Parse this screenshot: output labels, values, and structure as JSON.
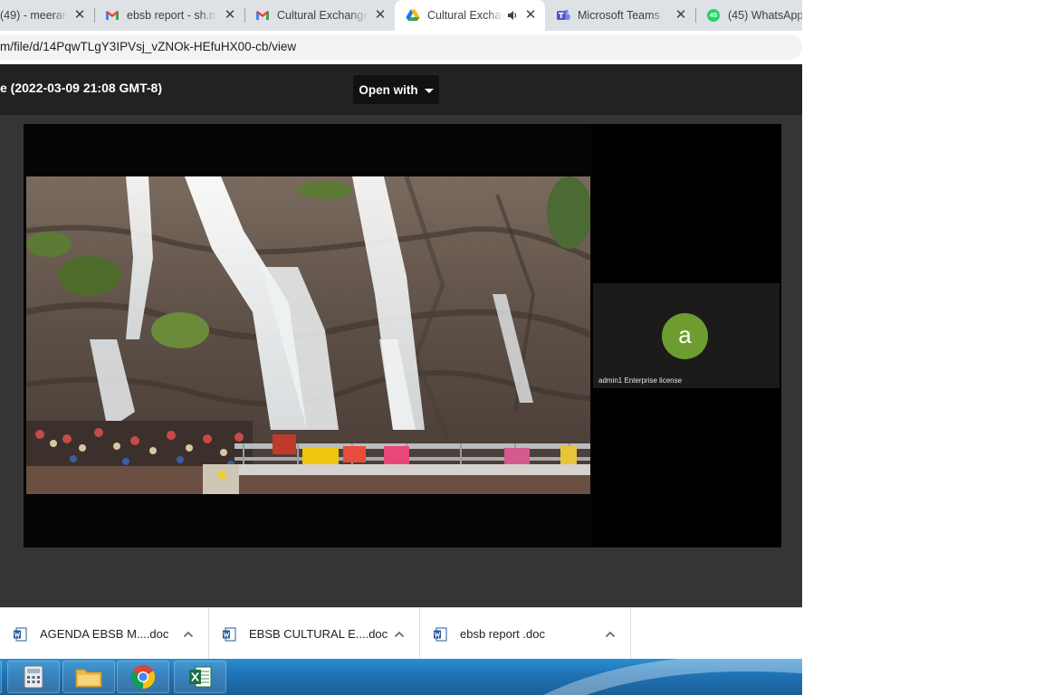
{
  "browser": {
    "tabs": [
      {
        "label": "(49) - meeran",
        "icon": "document-icon",
        "active": false
      },
      {
        "label": "ebsb report - sh.m",
        "icon": "gmail-icon",
        "active": false
      },
      {
        "label": "Cultural Exchange I",
        "icon": "gmail-icon",
        "active": false
      },
      {
        "label": "Cultural Exchan",
        "icon": "google-drive-icon",
        "active": true,
        "audio": true
      },
      {
        "label": "Microsoft Teams",
        "icon": "teams-icon",
        "active": false
      },
      {
        "label": "(45) WhatsApp",
        "icon": "whatsapp-icon",
        "active": false
      }
    ],
    "whatsapp_badge": "45",
    "close_glyph": "✕",
    "url": "m/file/d/14PqwTLgY3IPVsj_vZNOk-HEfuHX00-cb/view"
  },
  "viewer": {
    "title": "e (2022-03-09 21:08 GMT-8)",
    "open_with_label": "Open with",
    "participant": {
      "initial": "a",
      "label": "admin1 Enterprise license"
    }
  },
  "downloads": [
    {
      "name": "AGENDA EBSB M....doc",
      "icon": "word-icon"
    },
    {
      "name": "EBSB CULTURAL E....doc",
      "icon": "word-icon"
    },
    {
      "name": "ebsb report .doc",
      "icon": "word-icon"
    }
  ],
  "taskbar": {
    "apps": [
      "calculator-icon",
      "file-explorer-icon",
      "chrome-icon",
      "excel-icon"
    ]
  },
  "colors": {
    "accent": "#1a73e8",
    "avatar": "#6c9d2e",
    "viewer_bg": "#353535",
    "header_bg": "#222222"
  }
}
